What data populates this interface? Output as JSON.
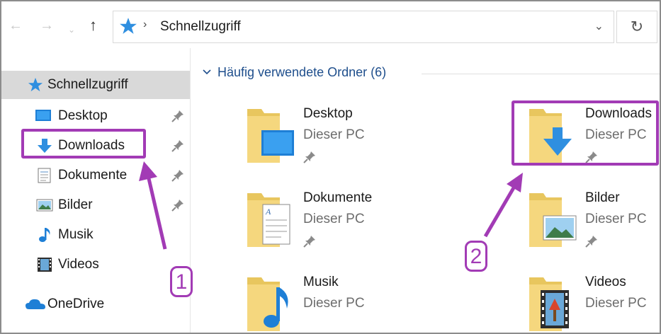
{
  "toolbar": {
    "back_icon": "arrow-left-icon",
    "forward_icon": "arrow-right-icon",
    "recent_icon": "chevron-down-icon",
    "up_icon": "arrow-up-icon",
    "address": {
      "location": "Schnellzugriff",
      "icon": "star-icon"
    },
    "refresh_icon": "refresh-icon"
  },
  "sidebar": {
    "items": [
      {
        "label": "Schnellzugriff",
        "icon": "star-icon",
        "pinned": false,
        "selected": true
      },
      {
        "label": "Desktop",
        "icon": "desktop-icon",
        "pinned": true
      },
      {
        "label": "Downloads",
        "icon": "download-icon",
        "pinned": true
      },
      {
        "label": "Dokumente",
        "icon": "document-icon",
        "pinned": true
      },
      {
        "label": "Bilder",
        "icon": "picture-icon",
        "pinned": true
      },
      {
        "label": "Musik",
        "icon": "music-icon",
        "pinned": false
      },
      {
        "label": "Videos",
        "icon": "video-icon",
        "pinned": false
      },
      {
        "label": "OneDrive",
        "icon": "cloud-icon",
        "pinned": false
      }
    ]
  },
  "main": {
    "group_title": "Häufig verwendete Ordner (6)",
    "tiles": [
      {
        "name": "Desktop",
        "location": "Dieser PC",
        "overlay_icon": "desktop-icon"
      },
      {
        "name": "Downloads",
        "location": "Dieser PC",
        "overlay_icon": "download-icon"
      },
      {
        "name": "Dokumente",
        "location": "Dieser PC",
        "overlay_icon": "document-icon"
      },
      {
        "name": "Bilder",
        "location": "Dieser PC",
        "overlay_icon": "picture-icon"
      },
      {
        "name": "Musik",
        "location": "Dieser PC",
        "overlay_icon": "music-icon"
      },
      {
        "name": "Videos",
        "location": "Dieser PC",
        "overlay_icon": "video-icon"
      }
    ]
  },
  "annotations": {
    "label_1": "1",
    "label_2": "2",
    "color": "#a23bb5"
  },
  "colors": {
    "link_blue": "#1e4e8c",
    "folder_yellow": "#f5d77e",
    "selected_bg": "#d9d9d9"
  }
}
